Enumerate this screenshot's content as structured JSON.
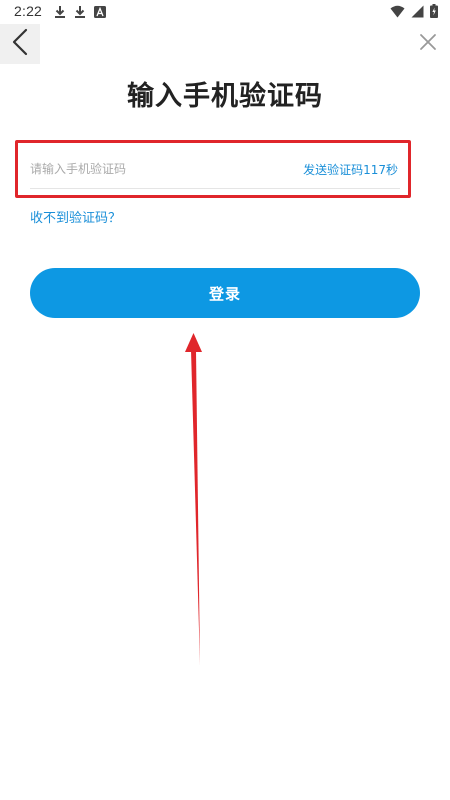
{
  "status_bar": {
    "time": "2:22",
    "left_icons": [
      "download-icon",
      "download-icon",
      "font-app-icon"
    ],
    "right_icons": [
      "wifi-icon",
      "signal-icon",
      "battery-charging-icon"
    ]
  },
  "nav": {
    "back_icon": "chevron-left-icon",
    "close_icon": "close-icon"
  },
  "page": {
    "title": "输入手机验证码"
  },
  "code_input": {
    "placeholder": "请输入手机验证码",
    "value": ""
  },
  "resend": {
    "label": "发送验证码117秒"
  },
  "help": {
    "label": "收不到验证码？"
  },
  "login": {
    "label": "登录"
  },
  "colors": {
    "accent": "#0d98e3",
    "link": "#1a8fd8",
    "annotation": "#e0262b"
  }
}
